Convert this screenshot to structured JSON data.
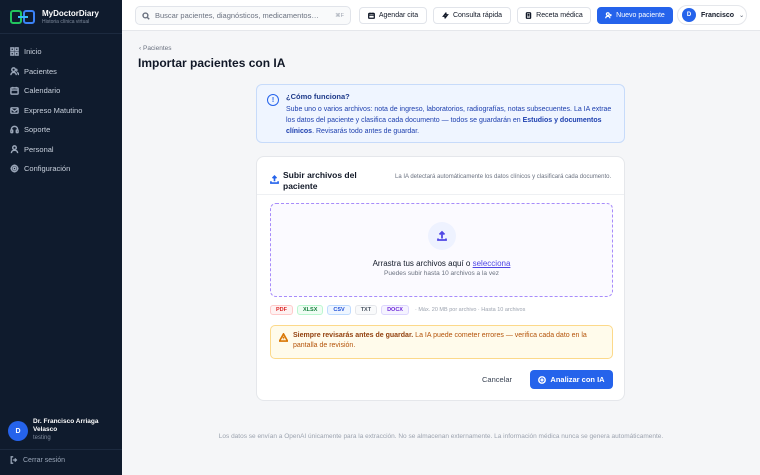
{
  "brand": {
    "name": "MyDoctorDiary",
    "tagline": "Historia clínica virtual"
  },
  "sidebar": {
    "items": [
      {
        "label": "Inicio",
        "icon": "grid-icon"
      },
      {
        "label": "Pacientes",
        "icon": "users-icon"
      },
      {
        "label": "Calendario",
        "icon": "calendar-icon"
      },
      {
        "label": "Expreso Matutino",
        "icon": "mail-icon"
      },
      {
        "label": "Soporte",
        "icon": "support-icon"
      },
      {
        "label": "Personal",
        "icon": "team-icon"
      },
      {
        "label": "Configuración",
        "icon": "gear-icon"
      }
    ],
    "user": {
      "initial": "D",
      "name": "Dr. Francisco Arriaga Velasco",
      "sub": "testing"
    },
    "logout": "Cerrar sesión"
  },
  "topbar": {
    "search_placeholder": "Buscar pacientes, diagnósticos, medicamentos…",
    "search_shortcut": "⌘F",
    "btn_agendar": "Agendar cita",
    "btn_consulta": "Consulta rápida",
    "btn_receta": "Receta médica",
    "btn_nuevo": "Nuevo paciente",
    "user_initial": "D",
    "user_name": "Francisco"
  },
  "breadcrumb": "Pacientes",
  "page_title": "Importar pacientes con IA",
  "info": {
    "title": "¿Cómo funciona?",
    "body_1": "Sube uno o varios archivos: nota de ingreso, laboratorios, radiografías, notas subsecuentes. La IA extrae los datos del paciente y clasifica cada documento — todos se guardarán en ",
    "body_bold": "Estudios y documentos clínicos",
    "body_2": ". Revisarás todo antes de guardar."
  },
  "upload": {
    "title": "Subir archivos del paciente",
    "desc": "La IA detectará automáticamente los datos clínicos y clasificará cada documento.",
    "drop_text": "Arrastra tus archivos aquí o ",
    "drop_link": "selecciona",
    "drop_sub": "Puedes subir hasta 10 archivos a la vez",
    "formats": [
      {
        "label": "PDF",
        "color": "#dc2626",
        "bg": "#fef2f2",
        "border": "#fecaca"
      },
      {
        "label": "XLSX",
        "color": "#15803d",
        "bg": "#f0fdf4",
        "border": "#bbf7d0"
      },
      {
        "label": "CSV",
        "color": "#1d4ed8",
        "bg": "#eff6ff",
        "border": "#bfdbfe"
      },
      {
        "label": "TXT",
        "color": "#4b5563",
        "bg": "#f9fafb",
        "border": "#e5e7eb"
      },
      {
        "label": "DOCX",
        "color": "#6d28d9",
        "bg": "#f5f3ff",
        "border": "#ddd6fe"
      }
    ],
    "limits": "· Máx. 20 MB por archivo · Hasta 10 archivos",
    "warn_bold": "Siempre revisarás antes de guardar.",
    "warn_text": " La IA puede cometer errores — verifica cada dato en la pantalla de revisión.",
    "cancel": "Cancelar",
    "analyze": "Analizar con IA"
  },
  "footer_note": "Los datos se envían a OpenAI únicamente para la extracción. No se almacenan externamente. La información médica nunca se genera automáticamente."
}
